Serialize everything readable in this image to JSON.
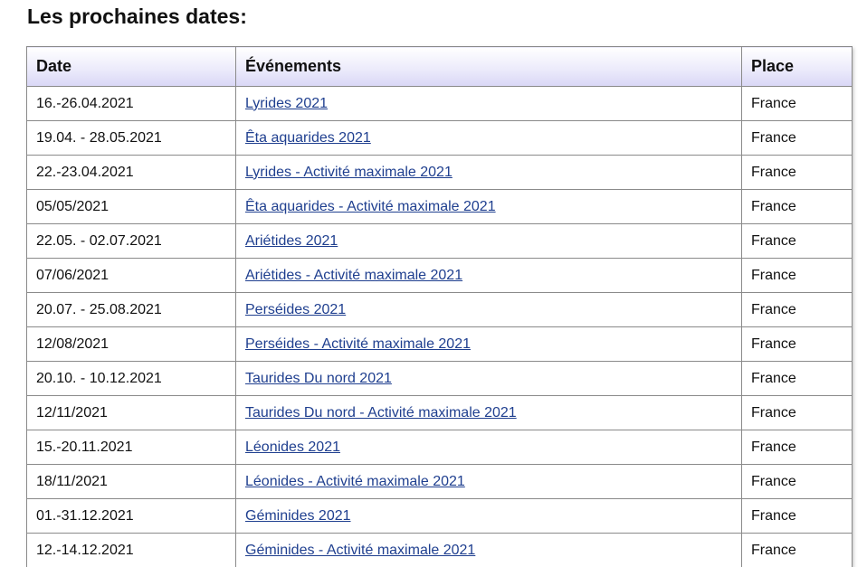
{
  "heading": "Les prochaines dates:",
  "table": {
    "headers": {
      "date": "Date",
      "event": "Événements",
      "place": "Place"
    },
    "rows": [
      {
        "date": "16.-26.04.2021",
        "event": "Lyrides 2021",
        "place": "France"
      },
      {
        "date": "19.04. - 28.05.2021",
        "event": "Êta aquarides 2021",
        "place": "France"
      },
      {
        "date": "22.-23.04.2021",
        "event": "Lyrides - Activité maximale 2021",
        "place": "France"
      },
      {
        "date": "05/05/2021",
        "event": "Êta aquarides - Activité maximale 2021",
        "place": "France"
      },
      {
        "date": "22.05. - 02.07.2021",
        "event": "Ariétides 2021",
        "place": "France"
      },
      {
        "date": "07/06/2021",
        "event": "Ariétides - Activité maximale 2021",
        "place": "France"
      },
      {
        "date": "20.07. - 25.08.2021",
        "event": "Perséides 2021",
        "place": "France"
      },
      {
        "date": "12/08/2021",
        "event": "Perséides - Activité maximale 2021",
        "place": "France"
      },
      {
        "date": "20.10. - 10.12.2021",
        "event": "Taurides Du nord 2021",
        "place": "France"
      },
      {
        "date": "12/11/2021",
        "event": "Taurides Du nord - Activité maximale 2021",
        "place": "France"
      },
      {
        "date": "15.-20.11.2021",
        "event": "Léonides 2021",
        "place": "France"
      },
      {
        "date": "18/11/2021",
        "event": "Léonides - Activité maximale 2021",
        "place": "France"
      },
      {
        "date": "01.-31.12.2021",
        "event": "Géminides 2021",
        "place": "France"
      },
      {
        "date": "12.-14.12.2021",
        "event": "Géminides - Activité maximale 2021",
        "place": "France"
      }
    ]
  },
  "colors": {
    "link": "#1f3f8f",
    "header_gradient_bottom": "#d9d7f6",
    "border": "#8a8a8a"
  }
}
